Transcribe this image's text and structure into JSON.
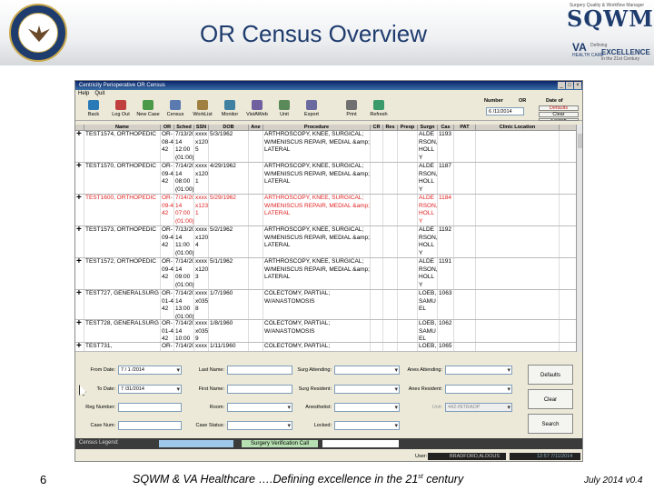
{
  "header": {
    "title": "OR Census Overview",
    "logo": {
      "tagline": "Surgery Quality & Workflow Manager",
      "brand": "SQWM",
      "va": "VA",
      "va_sub": "HEALTH CARE",
      "defining": "Defining",
      "excellence": "EXCELLENCE",
      "century": "in the 21st Century"
    }
  },
  "app": {
    "window_title": "Centricity Perioperative OR Census",
    "menu": [
      "Help",
      "Quit"
    ],
    "toolbar": [
      {
        "label": "Back",
        "icon": "back-arrow-icon",
        "color": "#2a7ab8"
      },
      {
        "label": "Log Out",
        "icon": "logout-icon",
        "color": "#c04040"
      },
      {
        "label": "New Case",
        "icon": "new-case-icon",
        "color": "#4a9a4a"
      },
      {
        "label": "Census",
        "icon": "census-icon",
        "color": "#5a7ab0"
      },
      {
        "label": "WorkList",
        "icon": "worklist-icon",
        "color": "#a08040"
      },
      {
        "label": "Monitor",
        "icon": "monitor-icon",
        "color": "#4080a0"
      },
      {
        "label": "VistAWeb",
        "icon": "vistaweb-icon",
        "color": "#7060a0"
      },
      {
        "label": "Unit",
        "icon": "unit-icon",
        "color": "#5a8a5a"
      },
      {
        "label": "Export",
        "icon": "export-icon",
        "color": "#6a6aa0"
      },
      {
        "label": "Print",
        "icon": "print-icon",
        "color": "#707070"
      },
      {
        "label": "Refresh",
        "icon": "refresh-icon",
        "color": "#3a9a6a"
      }
    ],
    "or_header": {
      "number_label": "Number",
      "or_label": "OR",
      "date_label": "Date of",
      "date_value": "6 /11/2014",
      "defaults_label": "Defaults",
      "clear_label": "Clear",
      "search_label": "Search"
    },
    "columns": [
      "",
      "Name",
      "OR",
      "Sched",
      "SSN",
      "DOB",
      "Ane",
      "Procedure",
      "CR",
      "Res",
      "Preop",
      "Surgn",
      "Cas",
      "PAT",
      "Clinic Location"
    ],
    "rows": [
      {
        "expand": "+",
        "name": "TEST1574, ORTHOPEDIC",
        "or": "OR- 08-4 42",
        "sched": "7/13/20 14 12:00 (01:00)",
        "ssn": "xxxx x120 5",
        "dob": "5/3/1962",
        "proc": "ARTHROSCOPY, KNEE, SURGICAL; W/MENISCUS REPAIR, MEDIAL &amp; LATERAL",
        "surgn": "ALDE RSON, HOLL Y",
        "cas": "1193",
        "red": false
      },
      {
        "expand": "+",
        "name": "TEST1570, ORTHOPEDIC",
        "or": "OR- 09-4 42",
        "sched": "7/14/20 14 08:00 (01:00)",
        "ssn": "xxxx x120 1",
        "dob": "4/29/1962",
        "proc": "ARTHROSCOPY, KNEE, SURGICAL; W/MENISCUS REPAIR, MEDIAL &amp; LATERAL",
        "surgn": "ALDE RSON, HOLL Y",
        "cas": "1187",
        "red": false
      },
      {
        "expand": "+",
        "name": "TEST1600, ORTHOPEDIC",
        "or": "OR- 09-4 42",
        "sched": "7/14/20 14 07:00 (01:00)",
        "ssn": "xxxx x123 1",
        "dob": "5/29/1962",
        "proc": "ARTHROSCOPY, KNEE, SURGICAL; W/MENISCUS REPAIR, MEDIAL &amp; LATERAL",
        "surgn": "ALDE RSON, HOLL Y",
        "cas": "1184",
        "red": true
      },
      {
        "expand": "+",
        "name": "TEST1573, ORTHOPEDIC",
        "or": "OR- 09-4 42",
        "sched": "7/13/20 14 11:00 (01:00)",
        "ssn": "xxxx x120 4",
        "dob": "5/2/1962",
        "proc": "ARTHROSCOPY, KNEE, SURGICAL; W/MENISCUS REPAIR, MEDIAL &amp; LATERAL",
        "surgn": "ALDE RSON, HOLL Y",
        "cas": "1192",
        "red": false
      },
      {
        "expand": "+",
        "name": "TEST1572, ORTHOPEDIC",
        "or": "OR- 09-4 42",
        "sched": "7/14/20 14 09:00 (01:00)",
        "ssn": "xxxx x120 3",
        "dob": "5/1/1962",
        "proc": "ARTHROSCOPY, KNEE, SURGICAL; W/MENISCUS REPAIR, MEDIAL &amp; LATERAL",
        "surgn": "ALDE RSON, HOLL Y",
        "cas": "1191",
        "red": false
      },
      {
        "expand": "+",
        "name": "TEST727, GENERALSURG",
        "or": "OR- 01-4 42",
        "sched": "7/14/20 14 13:00 (01:00)",
        "ssn": "xxxx x035 8",
        "dob": "1/7/1960",
        "proc": "COLECTOMY, PARTIAL; W/ANASTOMOSIS",
        "surgn": "LOEB, SAMU EL",
        "cas": "1063",
        "red": false
      },
      {
        "expand": "+",
        "name": "TEST728, GENERALSURG",
        "or": "OR- 01-4 42",
        "sched": "7/14/20 14 10:00 (01:00)",
        "ssn": "xxxx x035 9",
        "dob": "1/8/1960",
        "proc": "COLECTOMY, PARTIAL; W/ANASTOMOSIS",
        "surgn": "LOEB, SAMU EL",
        "cas": "1062",
        "red": false
      },
      {
        "expand": "+",
        "name": "TEST731,",
        "or": "OR-",
        "sched": "7/14/20",
        "ssn": "xxxx",
        "dob": "1/11/1960",
        "proc": "COLECTOMY, PARTIAL;",
        "surgn": "LOEB,",
        "cas": "1065",
        "red": false
      }
    ],
    "search": {
      "from_date_label": "From Date:",
      "from_date": "7 / 1 /2014",
      "to_date_label": "To Date:",
      "to_date": "7 /31/2014",
      "reg_label": "Reg Number:",
      "case_label": "Case Num:",
      "last_label": "Last Name:",
      "first_label": "First Name:",
      "room_label": "Room:",
      "status_label": "Case Status:",
      "surg_att_label": "Surg Attending:",
      "surg_res_label": "Surg Resident:",
      "anest_label": "Anesthetist:",
      "locked_label": "Locked:",
      "anes_att_label": "Anes Attending:",
      "anes_res_label": "Anes Resident:",
      "unit_label": "Unit:",
      "unit_value": "442-INTRAOP",
      "defaults_btn": "Defaults",
      "clear_btn": "Clear",
      "search_btn": "Search"
    },
    "legend": {
      "label": "Census Legend:",
      "verification": "Surgery Verification Call"
    },
    "status": {
      "user_label": "User:",
      "user": "BRADFORD,ALDOUS",
      "time": "12:57 7/11/2014"
    }
  },
  "footer": {
    "page": "6",
    "text": "SQWM & VA Healthcare ….Defining excellence in the 21",
    "sup": "st",
    "text2": " century",
    "date": "July 2014 v0.4"
  }
}
